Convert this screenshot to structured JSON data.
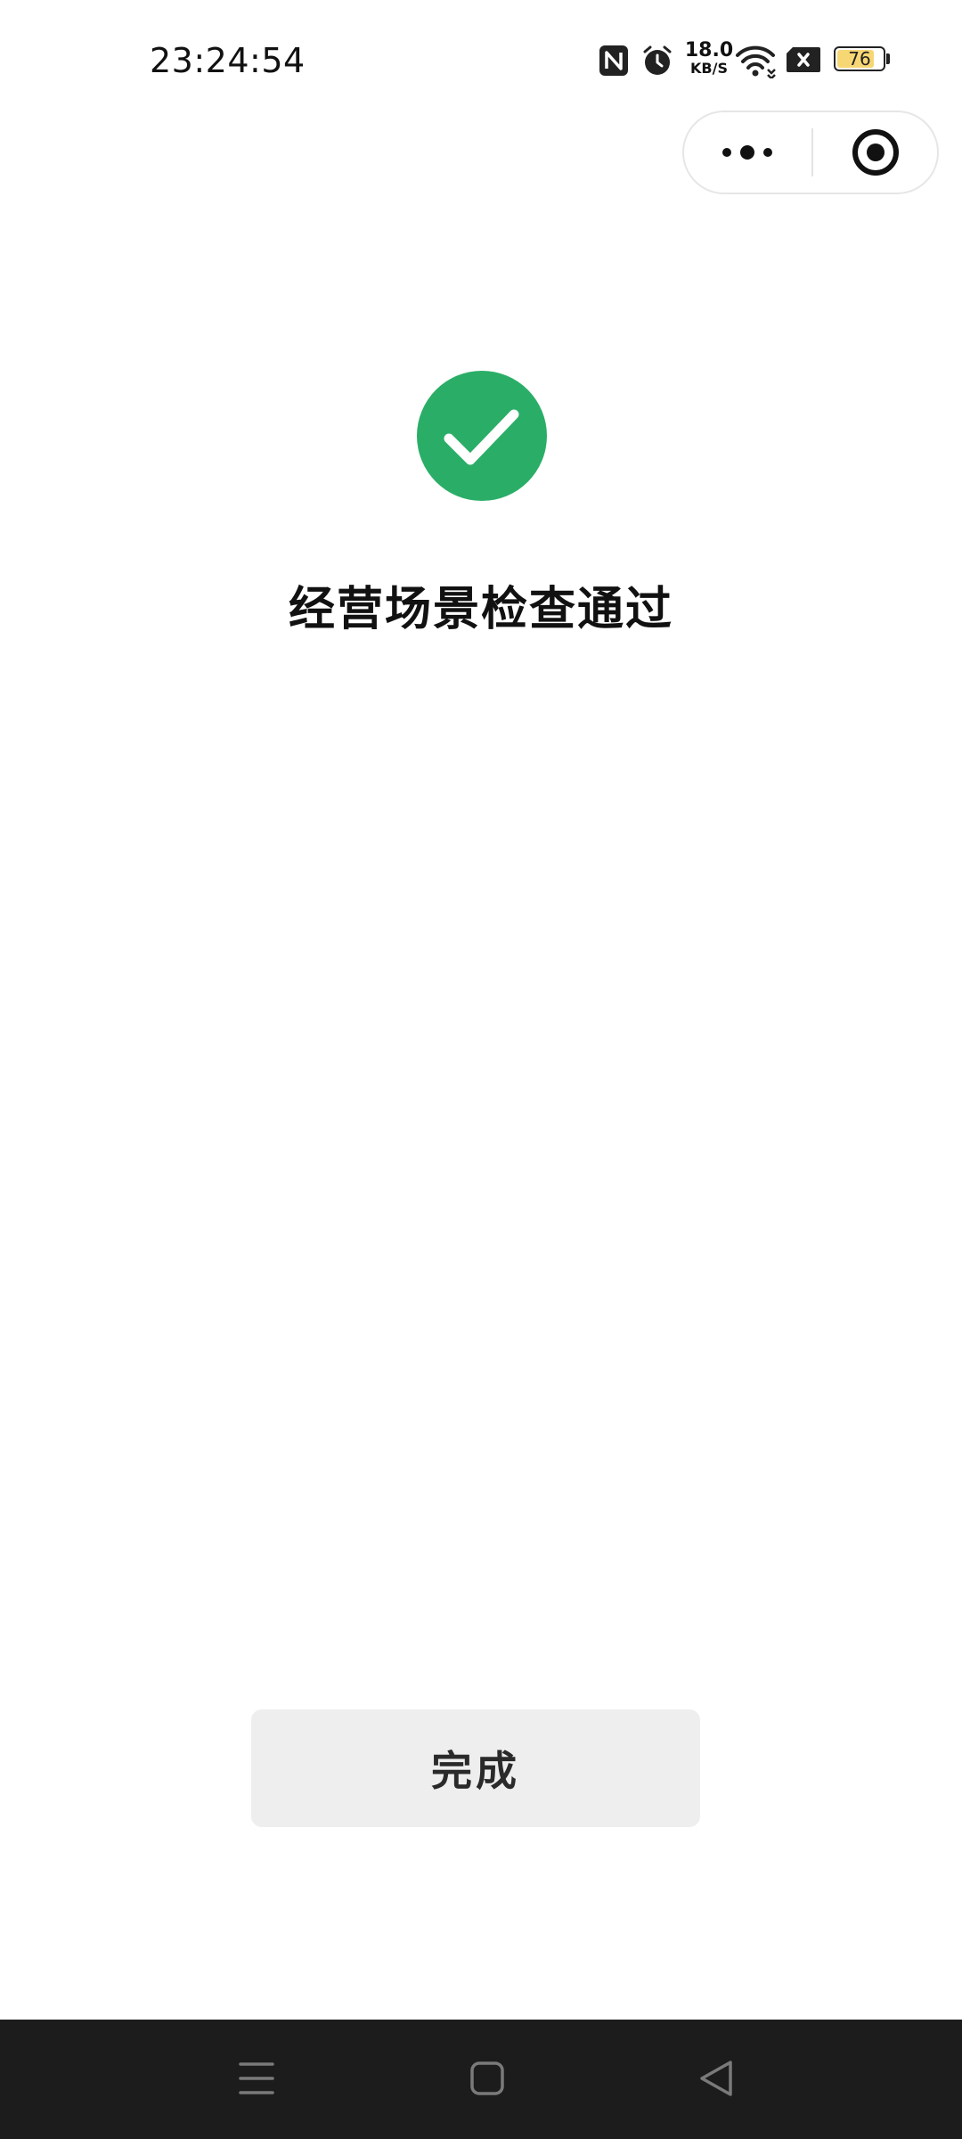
{
  "status_bar": {
    "time": "23:24:54",
    "net_speed_value": "18.0",
    "net_speed_unit": "KB/S",
    "battery_level": "76",
    "battery_fill_color": "#f7d774",
    "icons": [
      "nfc-icon",
      "alarm-icon",
      "wifi-icon",
      "sim-card-missing-icon",
      "battery-icon"
    ]
  },
  "capsule": {
    "icons": [
      "more-dots-icon",
      "close-target-icon"
    ]
  },
  "main": {
    "status_icon": "check-circle-icon",
    "accent_color": "#2aae67",
    "title": "经营场景检查通过",
    "done_button_label": "完成"
  },
  "nav_bar": {
    "icons": [
      "menu-icon",
      "home-square-icon",
      "back-triangle-icon"
    ]
  }
}
